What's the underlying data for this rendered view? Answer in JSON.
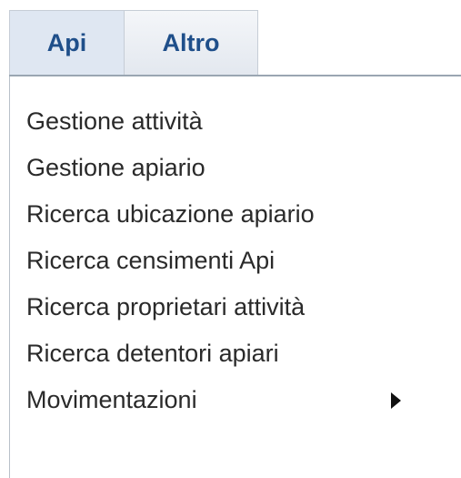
{
  "menubar": {
    "tabs": [
      {
        "label": "Api"
      },
      {
        "label": "Altro"
      }
    ]
  },
  "submenu": {
    "items": [
      {
        "label": "Gestione attività"
      },
      {
        "label": "Gestione apiario"
      },
      {
        "label": "Ricerca ubicazione apiario"
      },
      {
        "label": "Ricerca censimenti Api"
      },
      {
        "label": "Ricerca proprietari attività"
      },
      {
        "label": "Ricerca detentori apiari"
      },
      {
        "label": "Movimentazioni",
        "submenu_icon": "triangle-right-icon"
      }
    ]
  },
  "colors": {
    "tab_text": "#1f4f8a",
    "active_tab_bg": "#dfe7f2",
    "item_text": "#2a2a2a"
  }
}
